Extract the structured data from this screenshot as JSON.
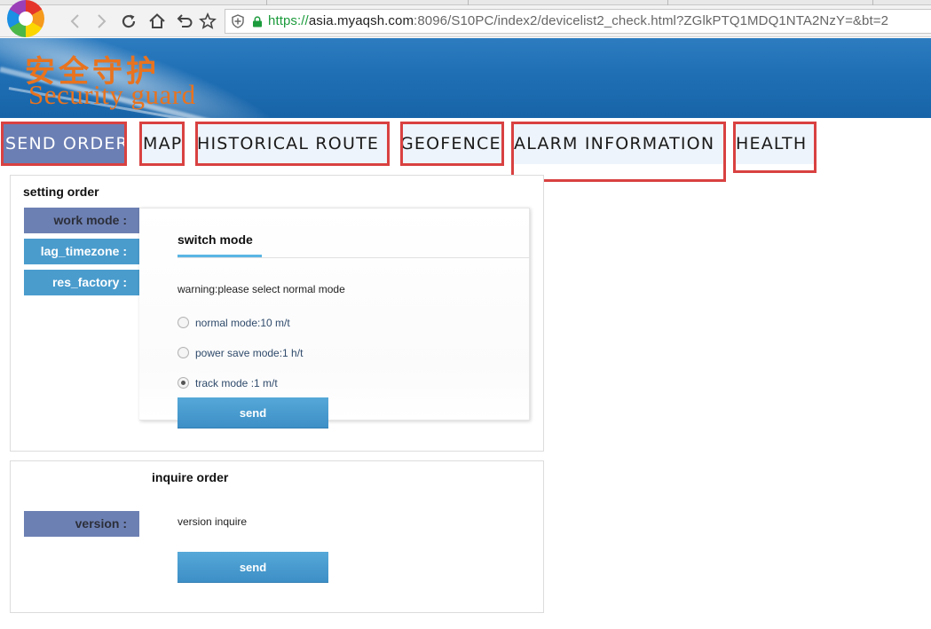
{
  "browser": {
    "url_scheme": "https://",
    "url_host": "asia.myaqsh.com",
    "url_rest": ":8096/S10PC/index2/devicelist2_check.html?ZGlkPTQ1MDQ1NTA2NzY=&bt=2",
    "icons": [
      "browser-logo-icon",
      "back-icon",
      "forward-icon",
      "reload-icon",
      "home-icon",
      "undo-icon",
      "star-icon",
      "shield-icon",
      "lock-icon"
    ]
  },
  "banner": {
    "chinese_title": "安全守护",
    "english_title": "Security guard",
    "accent_color": "#e8731f"
  },
  "nav": {
    "tabs": [
      {
        "label": "SEND ORDER",
        "active": true
      },
      {
        "label": "MAP"
      },
      {
        "label": "HISTORICAL ROUTE"
      },
      {
        "label": "GEOFENCE"
      },
      {
        "label": "ALARM INFORMATION"
      },
      {
        "label": "HEALTH"
      }
    ],
    "highlight_color": "#d94141"
  },
  "setting": {
    "title": "setting order",
    "side_buttons": [
      {
        "label": "work mode :",
        "active": true
      },
      {
        "label": "lag_timezone :"
      },
      {
        "label": "res_factory :"
      }
    ],
    "card": {
      "tab": "switch mode",
      "warning": "warning:please select normal mode",
      "options": [
        {
          "label": "normal mode:10 m/t",
          "checked": false
        },
        {
          "label": "power save mode:1 h/t",
          "checked": false
        },
        {
          "label": "track mode :1 m/t",
          "checked": true
        }
      ],
      "send_label": "send"
    }
  },
  "inquire": {
    "title": "inquire order",
    "side_button": "version :",
    "text": "version inquire",
    "send_label": "send"
  },
  "colors": {
    "button_blue": "#4a9ccd",
    "button_active": "#6d80b3",
    "banner_blue": "#1f6fb5"
  }
}
